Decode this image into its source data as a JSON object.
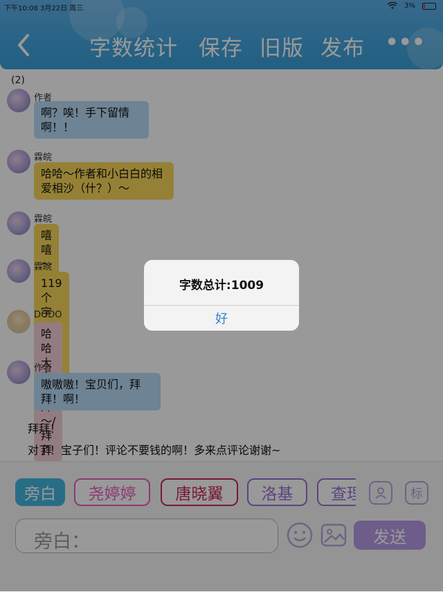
{
  "status_bar": {
    "time": "下午10:08",
    "date": "3月22日 周三",
    "battery": "3%"
  },
  "header": {
    "back_icon": "chevron-left-icon",
    "nav": {
      "word_count": "字数统计",
      "save": "保存",
      "old_version": "旧版",
      "publish": "发布"
    },
    "more_icon": "more-dots-icon",
    "more_label": "•••"
  },
  "conversation": {
    "counter": "(2)",
    "messages": [
      {
        "name": "作者",
        "text": "啊？唉！手下留情啊！！",
        "bubble_color": "#b7dbf7"
      },
      {
        "name": "霖皖",
        "text": "哈哈～作者和小白白的相爱相沙（什？）～",
        "bubble_color": "#f8d85a"
      },
      {
        "name": "霖皖",
        "text": "嘻嘻～好啦～",
        "bubble_color": "#f8d85a"
      },
      {
        "name": "霖皖",
        "text": "119个字～奉上～",
        "bubble_color": "#f8d85a"
      },
      {
        "name": "DODO",
        "text": "哈哈大家拜拜～/拜拜",
        "bubble_color": "#f5cfd8"
      },
      {
        "name": "作者",
        "text": "嗷嗷嗷！宝贝们，拜拜！啊！",
        "bubble_color": "#b7dbf7"
      }
    ],
    "narration": [
      "拜拜！",
      "对了！宝子们！评论不要钱的啊！多来点评论谢谢~"
    ]
  },
  "bottom_bar": {
    "roles": [
      {
        "label": "旁白",
        "color": "#44b6e0",
        "selected": true
      },
      {
        "label": "尧婷婷",
        "color": "#e85fc0"
      },
      {
        "label": "唐晓翼",
        "color": "#c92a55"
      },
      {
        "label": "洛基",
        "color": "#9a72d2"
      },
      {
        "label": "查理",
        "color": "#9a72d2"
      }
    ],
    "person_icon": "person-icon",
    "tag_label": "标",
    "input_placeholder": "旁白：",
    "emoji_icon": "smiley-icon",
    "image_icon": "image-icon",
    "send_label": "发送"
  },
  "dialog": {
    "title": "字数总计:1009",
    "ok_label": "好"
  },
  "colors": {
    "header": "#44a6df",
    "accent": "#b79be8",
    "dialog_button": "#2f7fd3"
  }
}
